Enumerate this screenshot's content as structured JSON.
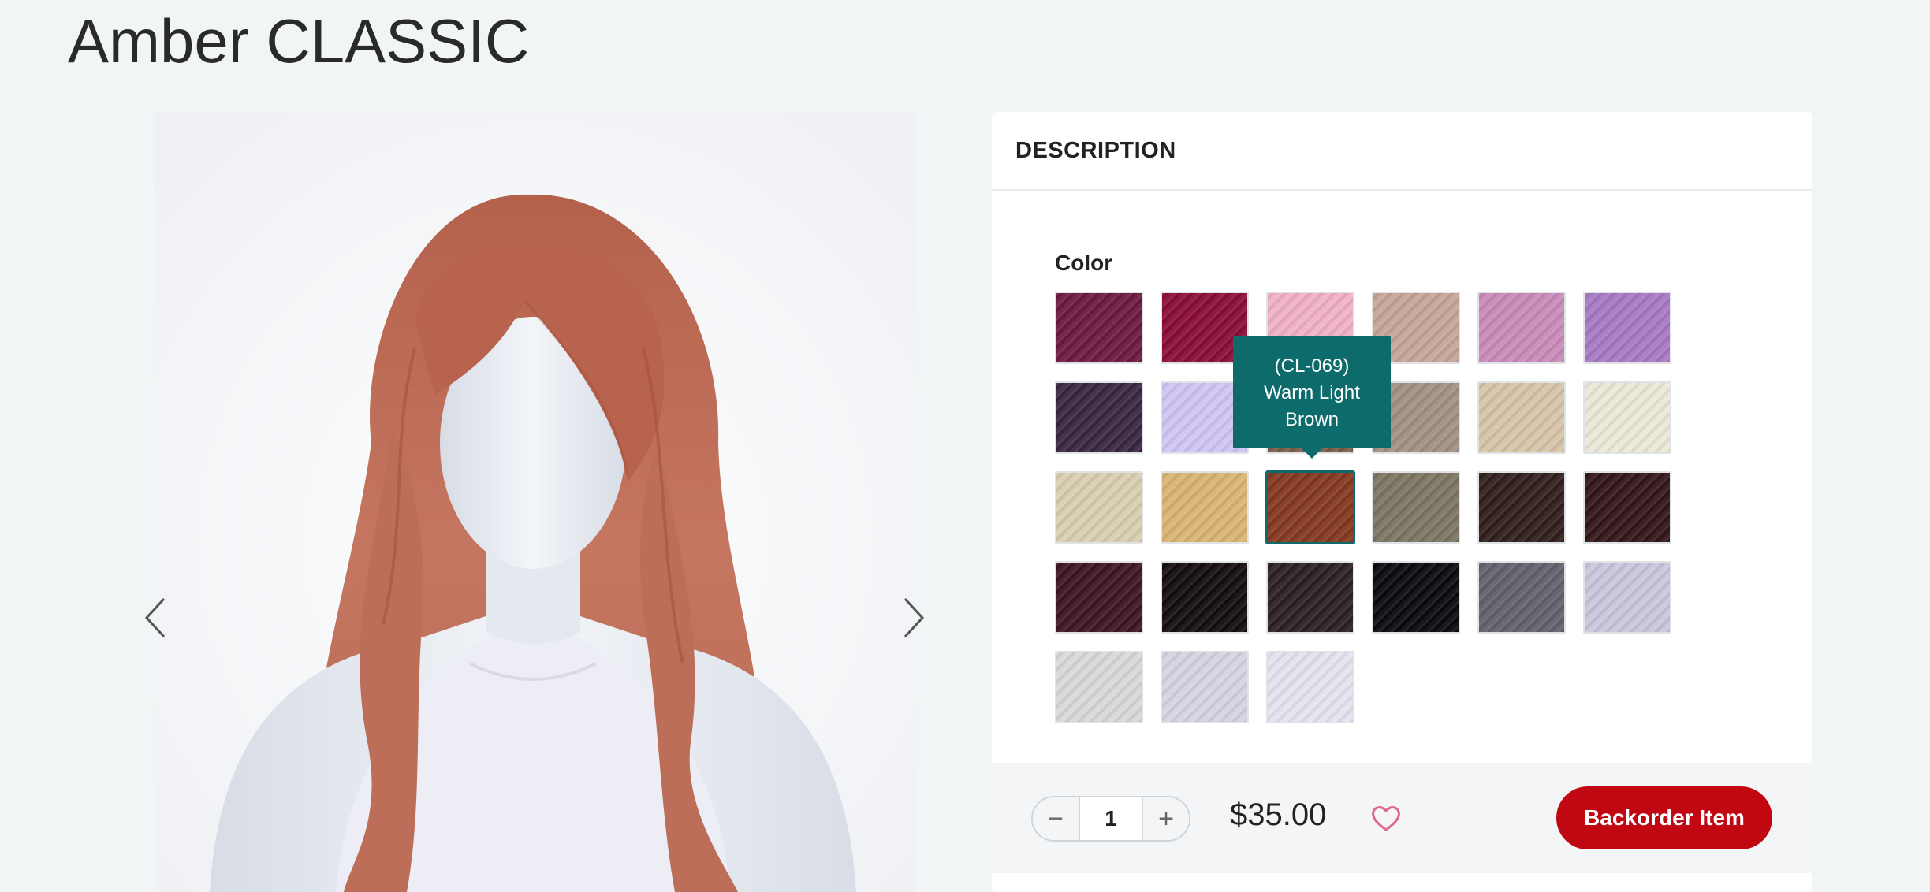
{
  "product": {
    "title": "Amber CLASSIC"
  },
  "gallery": {
    "prev_icon": "chevron-left-icon",
    "next_icon": "chevron-right-icon"
  },
  "description": {
    "heading": "DESCRIPTION",
    "color_label": "Color",
    "tooltip": {
      "code": "(CL-069)",
      "line1": "Warm Light",
      "line2": "Brown"
    },
    "swatches": [
      {
        "color": "#6e1a3e"
      },
      {
        "color": "#8a0e35"
      },
      {
        "color": "#f0b0c8"
      },
      {
        "color": "#c6a598"
      },
      {
        "color": "#c98ab9"
      },
      {
        "color": "#a779c2"
      },
      {
        "color": "#3a2640"
      },
      {
        "color": "#d0c4f2"
      },
      {
        "color": "#7a5a4a"
      },
      {
        "color": "#a28f84"
      },
      {
        "color": "#d6c4a6"
      },
      {
        "color": "#ebe8d8"
      },
      {
        "color": "#d8ceb0"
      },
      {
        "color": "#d8b474"
      },
      {
        "color": "#843820",
        "selected": true
      },
      {
        "color": "#7c7562"
      },
      {
        "color": "#301f1c"
      },
      {
        "color": "#331619"
      },
      {
        "color": "#3e1523"
      },
      {
        "color": "#130c10"
      },
      {
        "color": "#2b2022"
      },
      {
        "color": "#0c0a0e"
      },
      {
        "color": "#62616c"
      },
      {
        "color": "#c9c6dc"
      },
      {
        "color": "#d8d8d8"
      },
      {
        "color": "#d5d3e0"
      },
      {
        "color": "#e3e2ee"
      }
    ]
  },
  "purchase": {
    "minus_label": "−",
    "plus_label": "+",
    "quantity": "1",
    "price": "$35.00",
    "wishlist_icon": "heart-icon",
    "backorder_label": "Backorder Item"
  },
  "colors": {
    "tooltip_bg": "#0e6b6c",
    "button_bg": "#c00712",
    "hair": "#bf6b55"
  }
}
